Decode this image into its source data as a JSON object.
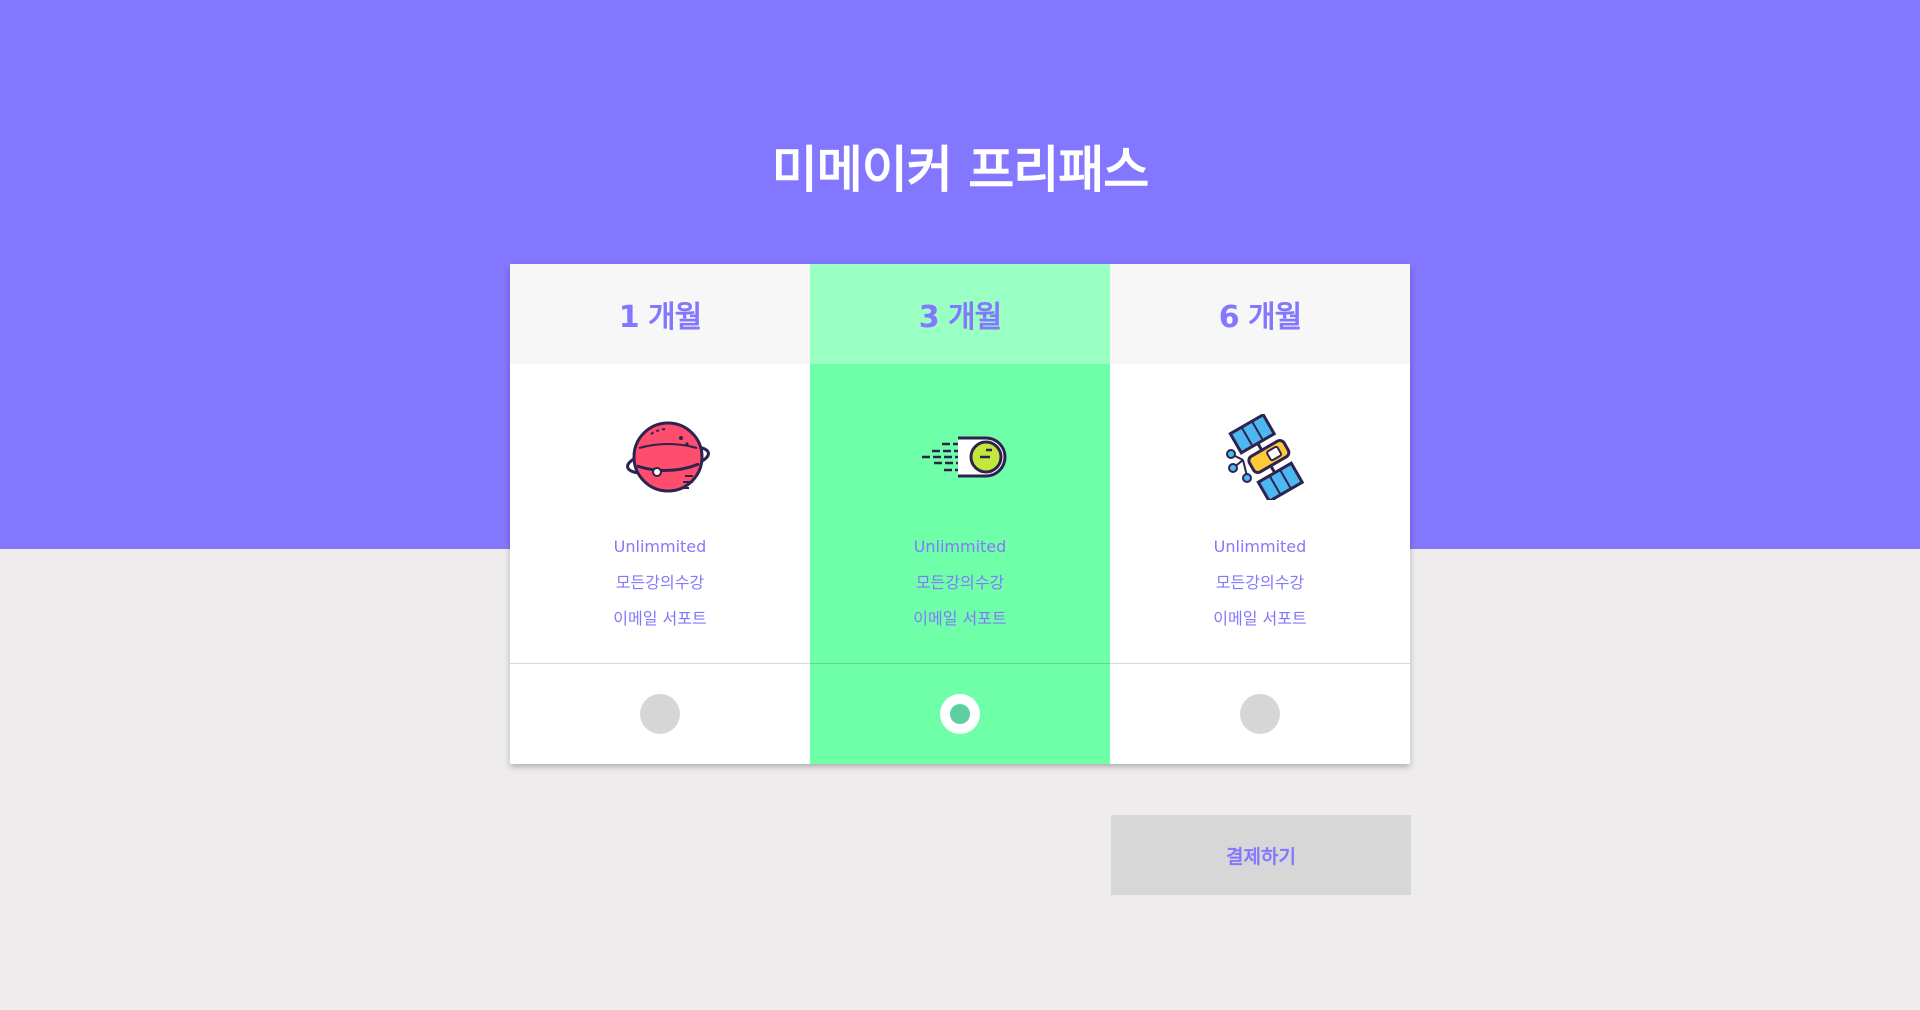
{
  "page": {
    "title": "미메이커 프리패스"
  },
  "plans": [
    {
      "name": "1 개월",
      "icon": "planet-icon",
      "features": [
        "Unlimmited",
        "모든강의수강",
        "이메일 서포트"
      ],
      "selected": false
    },
    {
      "name": "3 개월",
      "icon": "comet-icon",
      "features": [
        "Unlimmited",
        "모든강의수강",
        "이메일 서포트"
      ],
      "selected": true
    },
    {
      "name": "6 개월",
      "icon": "satellite-icon",
      "features": [
        "Unlimmited",
        "모든강의수강",
        "이메일 서포트"
      ],
      "selected": false
    }
  ],
  "actions": {
    "pay_label": "결제하기"
  },
  "colors": {
    "accent": "#8477ff",
    "selected_bg": "#6fffa8",
    "selected_head_bg": "#99ffc3",
    "page_bg": "#eeecec",
    "button_bg": "#d7d7d7"
  }
}
